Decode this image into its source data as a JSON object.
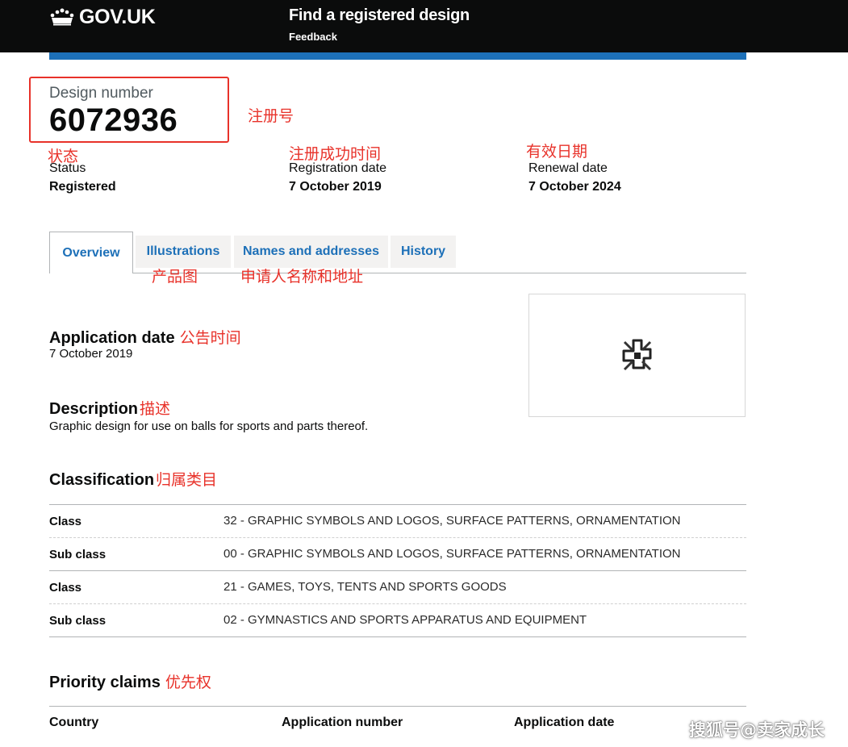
{
  "header": {
    "logo_text": "GOV.UK",
    "service_name": "Find a registered design",
    "feedback_label": "Feedback",
    "accent": "#1d70b8"
  },
  "design": {
    "number_label": "Design number",
    "number": "6072936",
    "status_label": "Status",
    "status": "Registered",
    "registration_date_label": "Registration date",
    "registration_date": "7 October 2019",
    "renewal_date_label": "Renewal date",
    "renewal_date": "7 October 2024"
  },
  "tabs": [
    {
      "label": "Overview",
      "active": true
    },
    {
      "label": "Illustrations",
      "active": false
    },
    {
      "label": "Names and addresses",
      "active": false
    },
    {
      "label": "History",
      "active": false
    }
  ],
  "overview": {
    "application_date_heading": "Application date",
    "application_date": "7 October 2019",
    "description_heading": "Description",
    "description": "Graphic design for use on balls for sports and parts thereof.",
    "classification_heading": "Classification",
    "classification": [
      {
        "key": "Class",
        "value": "32 - GRAPHIC SYMBOLS AND LOGOS, SURFACE PATTERNS, ORNAMENTATION"
      },
      {
        "key": "Sub class",
        "value": "00 - GRAPHIC SYMBOLS AND LOGOS, SURFACE PATTERNS, ORNAMENTATION"
      },
      {
        "key": "Class",
        "value": "21 - GAMES, TOYS, TENTS AND SPORTS GOODS"
      },
      {
        "key": "Sub class",
        "value": "02 - GYMNASTICS AND SPORTS APPARATUS AND EQUIPMENT"
      }
    ],
    "priority_heading": "Priority claims",
    "priority_columns": [
      "Country",
      "Application number",
      "Application date"
    ]
  },
  "annotations": {
    "design_number": "注册号",
    "status": "状态",
    "registration_date": "注册成功时间",
    "renewal_date": "有效日期",
    "illustrations": "产品图",
    "names_addresses": "申请人名称和地址",
    "application_date": "公告时间",
    "description": "描述",
    "classification": "归属类目",
    "priority": "优先权",
    "color": "#e8322a"
  },
  "watermark": "搜狐号@卖家成长"
}
